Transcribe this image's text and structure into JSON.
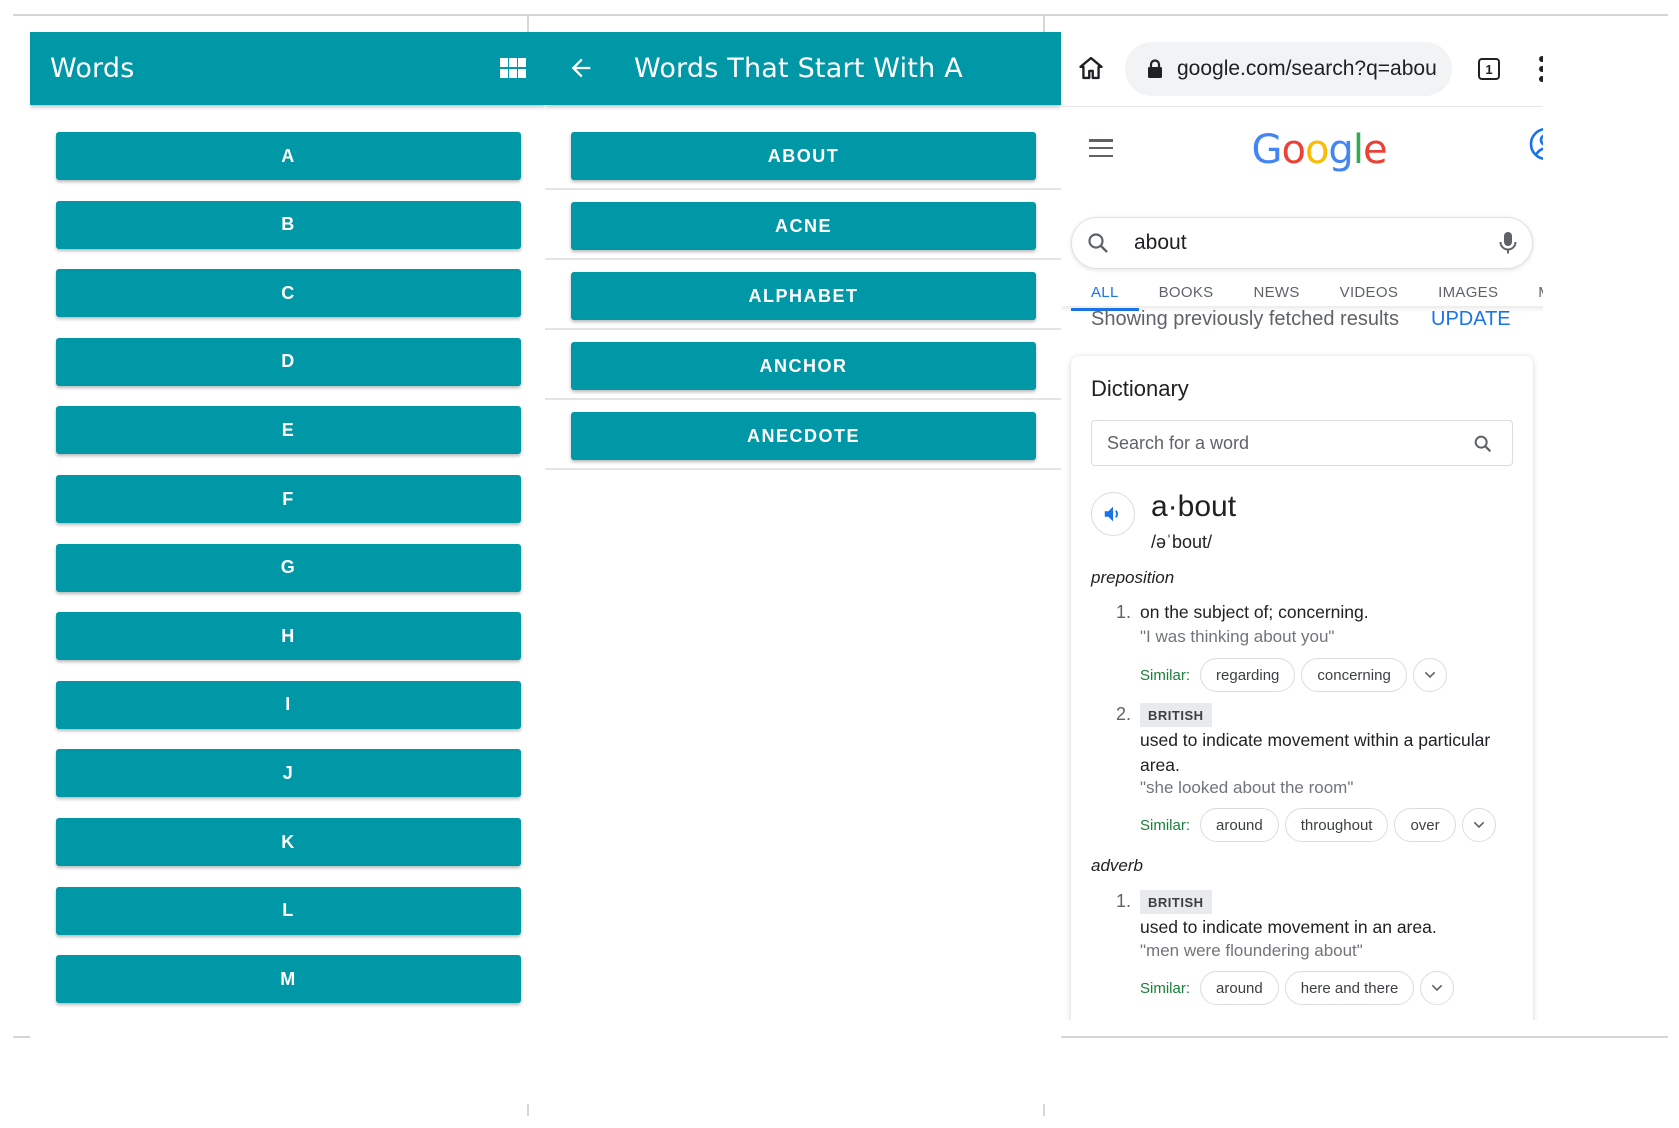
{
  "panel1": {
    "title": "Words",
    "letters": [
      "A",
      "B",
      "C",
      "D",
      "E",
      "F",
      "G",
      "H",
      "I",
      "J",
      "K",
      "L",
      "M"
    ]
  },
  "panel2": {
    "title": "Words That Start With A",
    "words": [
      "ABOUT",
      "ACNE",
      "ALPHABET",
      "ANCHOR",
      "ANECDOTE"
    ]
  },
  "panel3": {
    "url": "google.com/search?q=abou",
    "tab_count": "1",
    "logo": "Google",
    "query": "about",
    "tabs": [
      "ALL",
      "BOOKS",
      "NEWS",
      "VIDEOS",
      "IMAGES",
      "MAPS"
    ],
    "fetched_text": "Showing previously fetched results",
    "update_label": "UPDATE",
    "dictionary": {
      "title": "Dictionary",
      "search_placeholder": "Search for a word",
      "headword": "a·bout",
      "phonetic": "/əˈbout/",
      "similar_label": "Similar:",
      "pos1": "preposition",
      "def1_num": "1.",
      "def1": "on the subject of; concerning.",
      "def1_example": "\"I was thinking about you\"",
      "def1_similar": [
        "regarding",
        "concerning"
      ],
      "def2_num": "2.",
      "def2_badge": "BRITISH",
      "def2": "used to indicate movement within a particular area.",
      "def2_example": "\"she looked about the room\"",
      "def2_similar": [
        "around",
        "throughout",
        "over"
      ],
      "pos2": "adverb",
      "def3_num": "1.",
      "def3_badge": "BRITISH",
      "def3": "used to indicate movement in an area.",
      "def3_example": "\"men were floundering about\"",
      "def3_similar": [
        "around",
        "here and there"
      ]
    }
  },
  "colors": {
    "teal": "#0097a7",
    "google_blue": "#4285f4",
    "google_red": "#ea4335",
    "google_yellow": "#fbbc05",
    "google_green": "#34a853",
    "similar_green": "#188038"
  }
}
